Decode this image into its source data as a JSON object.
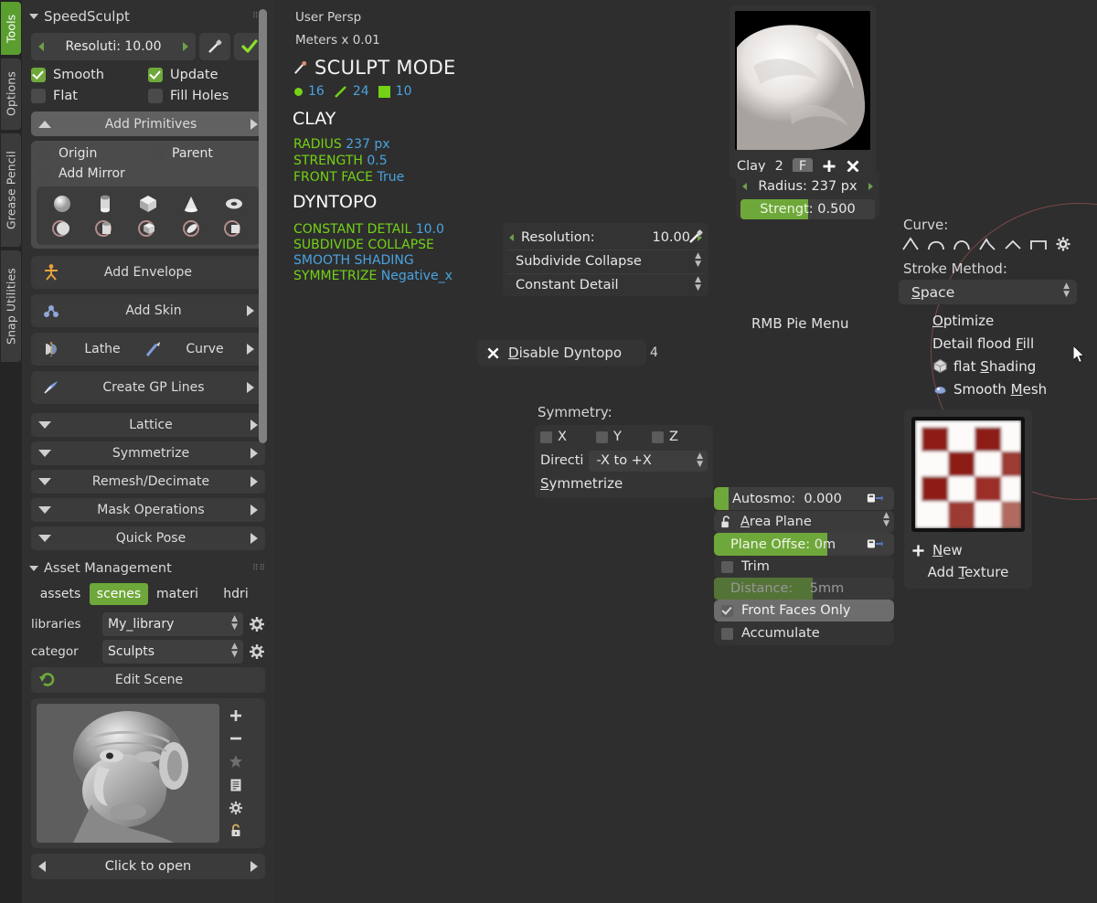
{
  "tabs": [
    {
      "label": "Tools",
      "active": true
    },
    {
      "label": "Options",
      "active": false
    },
    {
      "label": "Grease Pencil",
      "active": false
    },
    {
      "label": "Snap Utilities",
      "active": false
    }
  ],
  "sidebar": {
    "title": "SpeedSculpt",
    "resolution": {
      "label": "Resoluti:",
      "value": "10.00"
    },
    "eyedropper_icon": "eyedropper-icon",
    "confirm_icon": "checkmark-icon",
    "checks": [
      {
        "label": "Smooth",
        "checked": true
      },
      {
        "label": "Update",
        "checked": true
      },
      {
        "label": "Flat",
        "checked": false
      },
      {
        "label": "Fill Holes",
        "checked": false
      }
    ],
    "add_primitives": {
      "label": "Add Primitives"
    },
    "primitive_options": [
      {
        "label": "Origin",
        "checked": false
      },
      {
        "label": "Parent",
        "checked": false
      },
      {
        "label": "Add Mirror",
        "checked": false
      }
    ],
    "primitives_row1": [
      "sphere-icon",
      "cylinder-icon",
      "cube-icon",
      "cone-icon",
      "torus-icon"
    ],
    "primitives_row2": [
      "sphere-mirror-icon",
      "cylinder-mirror-icon",
      "cube-mirror-icon",
      "cone-mirror-icon",
      "plane-mirror-icon"
    ],
    "buttons": [
      {
        "label": "Add Envelope",
        "icon": "armature-icon",
        "arrow": false
      },
      {
        "label": "Add Skin",
        "icon": "skin-icon",
        "arrow": true
      }
    ],
    "lathe_curve": {
      "lathe": "Lathe",
      "curve": "Curve",
      "lathe_icon": "lathe-icon",
      "curve_icon": "curve-pen-icon"
    },
    "create_gp": {
      "label": "Create GP Lines",
      "icon": "grease-pencil-icon"
    },
    "collapsed_sections": [
      {
        "label": "Lattice"
      },
      {
        "label": "Symmetrize"
      },
      {
        "label": "Remesh/Decimate"
      },
      {
        "label": "Mask Operations"
      },
      {
        "label": "Quick Pose"
      }
    ],
    "asset_management": {
      "title": "Asset Management",
      "tags": [
        {
          "label": "assets",
          "selected": false
        },
        {
          "label": "scenes",
          "selected": true
        },
        {
          "label": "materi",
          "selected": false
        },
        {
          "label": "hdri",
          "selected": false
        }
      ],
      "libraries": {
        "key": "libraries",
        "value": "My_library"
      },
      "category": {
        "key": "categor",
        "value": "Sculpts"
      },
      "edit_scene": {
        "label": "Edit Scene",
        "icon": "revert-icon"
      },
      "side_icons": [
        "plus-icon",
        "minus-icon",
        "star-icon",
        "list-icon",
        "gear-icon",
        "lock-icon"
      ],
      "open_bar": {
        "label": "Click to open"
      }
    }
  },
  "viewport": {
    "persp": "User Persp",
    "units": "Meters x 0.01",
    "mode": "SCULPT MODE",
    "mode_icon": "sculpt-brush-icon",
    "stats": [
      {
        "icon": "vertex-dot-icon",
        "value": "16"
      },
      {
        "icon": "edge-line-icon",
        "value": "24"
      },
      {
        "icon": "face-square-icon",
        "value": "10"
      }
    ],
    "brush_title": "CLAY",
    "brush_props": [
      {
        "key": "RADIUS",
        "value": "237 px"
      },
      {
        "key": "STRENGTH",
        "value": "0.5"
      },
      {
        "key": "FRONT FACE",
        "value": "True"
      }
    ],
    "dyntopo_title": "DYNTOPO",
    "dyntopo_props": [
      {
        "key": "CONSTANT DETAIL",
        "value": "10.0"
      },
      {
        "key": "SUBDIVIDE COLLAPSE",
        "value": ""
      },
      {
        "key": "SMOOTH SHADING",
        "value": "",
        "blue": true
      },
      {
        "key": "SYMMETRIZE",
        "value": "Negative_x"
      }
    ],
    "pie_menu_label": "RMB Pie Menu",
    "cursor_icon": "mouse-pointer-icon"
  },
  "brush_panel": {
    "name": "Clay",
    "users": "2",
    "fake_user": "F",
    "new_icon": "plus-icon",
    "delete_icon": "close-x-icon",
    "radius": {
      "label": "Radius:",
      "value": "237 px"
    },
    "strength": {
      "label": "Strengt:",
      "value": "0.500",
      "fill_pct": 50
    }
  },
  "dyntopo_panel": {
    "resolution": {
      "label": "Resolution:",
      "value": "10.00"
    },
    "eyedropper_icon": "eyedropper-icon",
    "mode": "Subdivide Collapse",
    "detail_type": "Constant Detail",
    "disable": {
      "label": "Disable Dyntopo",
      "icon": "close-x-icon",
      "shortcut": "4"
    }
  },
  "symmetry_panel": {
    "title": "Symmetry:",
    "axes": [
      {
        "label": "X",
        "checked": false
      },
      {
        "label": "Y",
        "checked": false
      },
      {
        "label": "Z",
        "checked": false
      }
    ],
    "direction": {
      "key": "Directi",
      "value": "-X to +X"
    },
    "symmetrize_label": "Symmetrize"
  },
  "curve_panel": {
    "title": "Curve:",
    "curve_icons": [
      "curve-sharp-icon",
      "curve-smooth-icon",
      "curve-round-icon",
      "curve-root-icon",
      "curve-sphere-icon",
      "curve-max-icon"
    ],
    "gear_icon": "gear-icon",
    "stroke_title": "Stroke Method:",
    "stroke_value": "Space",
    "menu": [
      {
        "label": "Optimize",
        "icon": null,
        "accel": "O"
      },
      {
        "label": "Detail flood Fill",
        "icon": null,
        "accel": "F"
      },
      {
        "label": "flat Shading",
        "icon": "flat-shading-icon",
        "accel": "S"
      },
      {
        "label": "Smooth Mesh",
        "icon": "smooth-mesh-icon",
        "accel": "M"
      }
    ]
  },
  "brush_options": {
    "autosmooth": {
      "label": "Autosmo:",
      "value": "0.000",
      "fill_pct": 8,
      "anim_icon": "animate-icon"
    },
    "area_plane": {
      "label": "Area Plane",
      "lock_icon": "unlock-icon"
    },
    "plane_offset": {
      "label": "Plane Offse:",
      "value": "0m",
      "fill_pct": 63,
      "anim_icon": "animate-icon"
    },
    "trim": {
      "label": "Trim",
      "checked": false
    },
    "distance": {
      "label": "Distance:",
      "value": "5mm",
      "fill_pct": 55,
      "disabled": true
    },
    "front_faces_only": {
      "label": "Front Faces Only",
      "checked": true,
      "highlighted": true
    },
    "accumulate": {
      "label": "Accumulate",
      "checked": false
    }
  },
  "texture_panel": {
    "preview_icon": "checker-texture-preview",
    "new_label": "New",
    "new_icon": "plus-icon",
    "add_texture_label": "Add Texture"
  },
  "colors": {
    "accent_green": "#6fa83a",
    "hud_green": "#73d216",
    "hud_blue": "#4aa3df",
    "panel_bg": "#333333",
    "sidebar_bg": "#303030",
    "viewport_bg": "#2e2e2e",
    "pie_ring": "#8d4b4b",
    "tab_active": "#5a9e2f"
  }
}
